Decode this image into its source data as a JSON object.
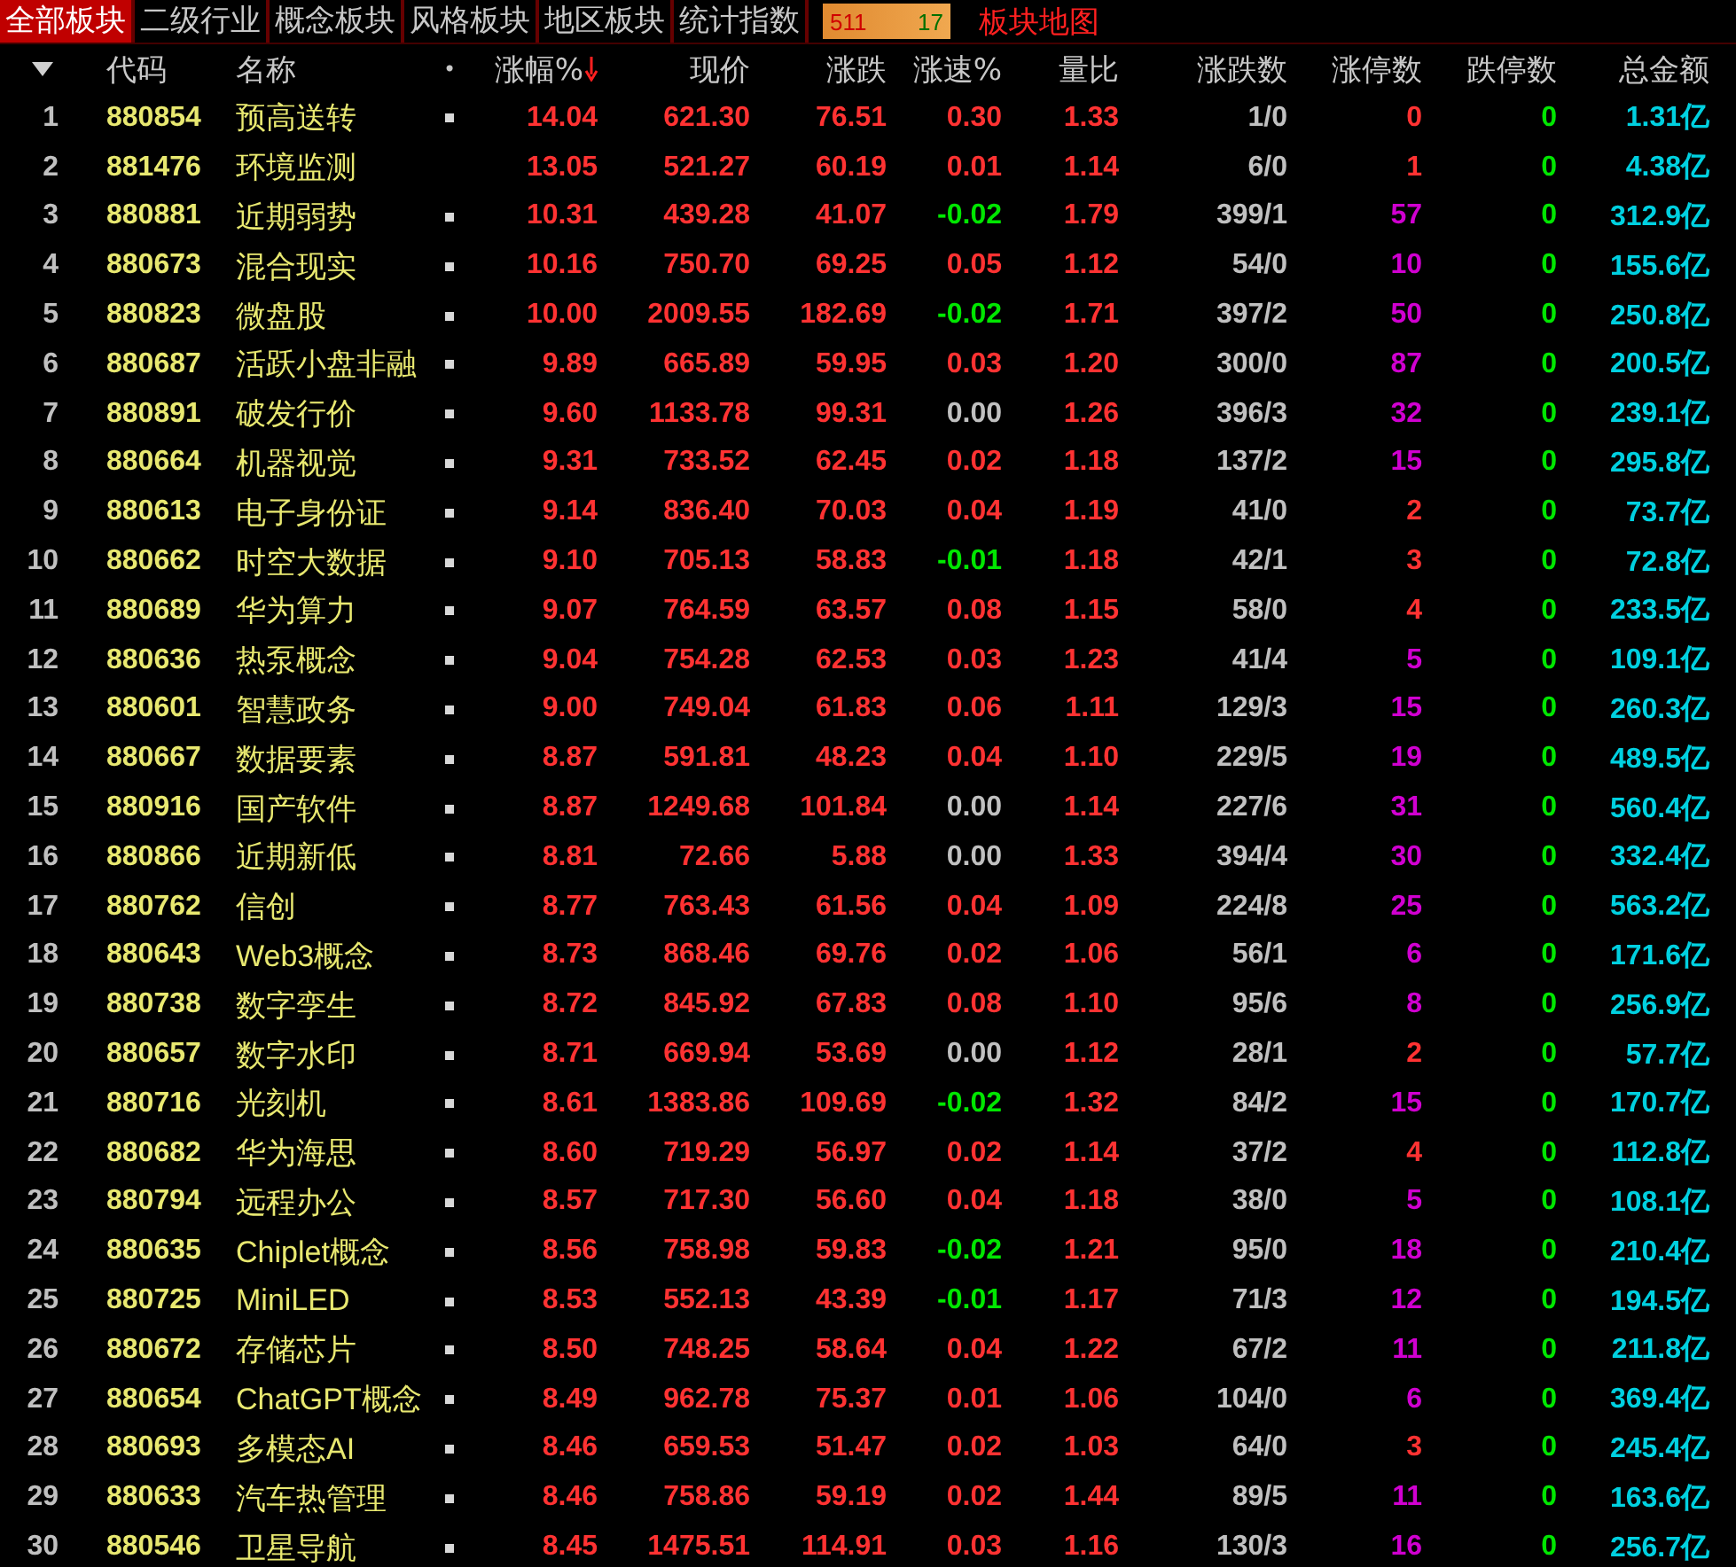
{
  "tabs": [
    {
      "label": "全部板块",
      "selected": true
    },
    {
      "label": "二级行业",
      "selected": false
    },
    {
      "label": "概念板块",
      "selected": false
    },
    {
      "label": "风格板块",
      "selected": false
    },
    {
      "label": "地区板块",
      "selected": false
    },
    {
      "label": "统计指数",
      "selected": false
    }
  ],
  "counter": {
    "up": "511",
    "down": "17"
  },
  "map_link": "板块地图",
  "columns": [
    {
      "label": "代码",
      "sorted": false
    },
    {
      "label": "名称",
      "sorted": false
    },
    {
      "label": "•",
      "sorted": false
    },
    {
      "label": "涨幅%",
      "sorted": true
    },
    {
      "label": "现价",
      "sorted": false
    },
    {
      "label": "涨跌",
      "sorted": false
    },
    {
      "label": "涨速%",
      "sorted": false
    },
    {
      "label": "量比",
      "sorted": false
    },
    {
      "label": "涨跌数",
      "sorted": false
    },
    {
      "label": "涨停数",
      "sorted": false
    },
    {
      "label": "跌停数",
      "sorted": false
    },
    {
      "label": "总金额",
      "sorted": false
    }
  ],
  "rows": [
    {
      "index": "1",
      "code": "880854",
      "name": "预高送转",
      "marked": true,
      "pct": "14.04",
      "price": "621.30",
      "change": "76.51",
      "speed": {
        "text": "0.30",
        "color": "#ff3232"
      },
      "ratio": "1.33",
      "up_down": "1/0",
      "limit_up": {
        "text": "0",
        "color": "#ff3232"
      },
      "limit_down": "0",
      "amount": "1.31亿"
    },
    {
      "index": "2",
      "code": "881476",
      "name": "环境监测",
      "marked": false,
      "pct": "13.05",
      "price": "521.27",
      "change": "60.19",
      "speed": {
        "text": "0.01",
        "color": "#ff3232"
      },
      "ratio": "1.14",
      "up_down": "6/0",
      "limit_up": {
        "text": "1",
        "color": "#ff3232"
      },
      "limit_down": "0",
      "amount": "4.38亿"
    },
    {
      "index": "3",
      "code": "880881",
      "name": "近期弱势",
      "marked": true,
      "pct": "10.31",
      "price": "439.28",
      "change": "41.07",
      "speed": {
        "text": "-0.02",
        "color": "#00e600"
      },
      "ratio": "1.79",
      "up_down": "399/1",
      "limit_up": {
        "text": "57",
        "color": "#d000d0"
      },
      "limit_down": "0",
      "amount": "312.9亿"
    },
    {
      "index": "4",
      "code": "880673",
      "name": "混合现实",
      "marked": true,
      "pct": "10.16",
      "price": "750.70",
      "change": "69.25",
      "speed": {
        "text": "0.05",
        "color": "#ff3232"
      },
      "ratio": "1.12",
      "up_down": "54/0",
      "limit_up": {
        "text": "10",
        "color": "#d000d0"
      },
      "limit_down": "0",
      "amount": "155.6亿"
    },
    {
      "index": "5",
      "code": "880823",
      "name": "微盘股",
      "marked": true,
      "pct": "10.00",
      "price": "2009.55",
      "change": "182.69",
      "speed": {
        "text": "-0.02",
        "color": "#00e600"
      },
      "ratio": "1.71",
      "up_down": "397/2",
      "limit_up": {
        "text": "50",
        "color": "#d000d0"
      },
      "limit_down": "0",
      "amount": "250.8亿"
    },
    {
      "index": "6",
      "code": "880687",
      "name": "活跃小盘非融",
      "marked": true,
      "pct": "9.89",
      "price": "665.89",
      "change": "59.95",
      "speed": {
        "text": "0.03",
        "color": "#ff3232"
      },
      "ratio": "1.20",
      "up_down": "300/0",
      "limit_up": {
        "text": "87",
        "color": "#d000d0"
      },
      "limit_down": "0",
      "amount": "200.5亿"
    },
    {
      "index": "7",
      "code": "880891",
      "name": "破发行价",
      "marked": true,
      "pct": "9.60",
      "price": "1133.78",
      "change": "99.31",
      "speed": {
        "text": "0.00",
        "color": "#c0c0c0"
      },
      "ratio": "1.26",
      "up_down": "396/3",
      "limit_up": {
        "text": "32",
        "color": "#d000d0"
      },
      "limit_down": "0",
      "amount": "239.1亿"
    },
    {
      "index": "8",
      "code": "880664",
      "name": "机器视觉",
      "marked": true,
      "pct": "9.31",
      "price": "733.52",
      "change": "62.45",
      "speed": {
        "text": "0.02",
        "color": "#ff3232"
      },
      "ratio": "1.18",
      "up_down": "137/2",
      "limit_up": {
        "text": "15",
        "color": "#d000d0"
      },
      "limit_down": "0",
      "amount": "295.8亿"
    },
    {
      "index": "9",
      "code": "880613",
      "name": "电子身份证",
      "marked": true,
      "pct": "9.14",
      "price": "836.40",
      "change": "70.03",
      "speed": {
        "text": "0.04",
        "color": "#ff3232"
      },
      "ratio": "1.19",
      "up_down": "41/0",
      "limit_up": {
        "text": "2",
        "color": "#ff3232"
      },
      "limit_down": "0",
      "amount": "73.7亿"
    },
    {
      "index": "10",
      "code": "880662",
      "name": "时空大数据",
      "marked": true,
      "pct": "9.10",
      "price": "705.13",
      "change": "58.83",
      "speed": {
        "text": "-0.01",
        "color": "#00e600"
      },
      "ratio": "1.18",
      "up_down": "42/1",
      "limit_up": {
        "text": "3",
        "color": "#ff3232"
      },
      "limit_down": "0",
      "amount": "72.8亿"
    },
    {
      "index": "11",
      "code": "880689",
      "name": "华为算力",
      "marked": true,
      "pct": "9.07",
      "price": "764.59",
      "change": "63.57",
      "speed": {
        "text": "0.08",
        "color": "#ff3232"
      },
      "ratio": "1.15",
      "up_down": "58/0",
      "limit_up": {
        "text": "4",
        "color": "#ff3232"
      },
      "limit_down": "0",
      "amount": "233.5亿"
    },
    {
      "index": "12",
      "code": "880636",
      "name": "热泵概念",
      "marked": true,
      "pct": "9.04",
      "price": "754.28",
      "change": "62.53",
      "speed": {
        "text": "0.03",
        "color": "#ff3232"
      },
      "ratio": "1.23",
      "up_down": "41/4",
      "limit_up": {
        "text": "5",
        "color": "#d000d0"
      },
      "limit_down": "0",
      "amount": "109.1亿"
    },
    {
      "index": "13",
      "code": "880601",
      "name": "智慧政务",
      "marked": true,
      "pct": "9.00",
      "price": "749.04",
      "change": "61.83",
      "speed": {
        "text": "0.06",
        "color": "#ff3232"
      },
      "ratio": "1.11",
      "up_down": "129/3",
      "limit_up": {
        "text": "15",
        "color": "#d000d0"
      },
      "limit_down": "0",
      "amount": "260.3亿"
    },
    {
      "index": "14",
      "code": "880667",
      "name": "数据要素",
      "marked": true,
      "pct": "8.87",
      "price": "591.81",
      "change": "48.23",
      "speed": {
        "text": "0.04",
        "color": "#ff3232"
      },
      "ratio": "1.10",
      "up_down": "229/5",
      "limit_up": {
        "text": "19",
        "color": "#d000d0"
      },
      "limit_down": "0",
      "amount": "489.5亿"
    },
    {
      "index": "15",
      "code": "880916",
      "name": "国产软件",
      "marked": true,
      "pct": "8.87",
      "price": "1249.68",
      "change": "101.84",
      "speed": {
        "text": "0.00",
        "color": "#c0c0c0"
      },
      "ratio": "1.14",
      "up_down": "227/6",
      "limit_up": {
        "text": "31",
        "color": "#d000d0"
      },
      "limit_down": "0",
      "amount": "560.4亿"
    },
    {
      "index": "16",
      "code": "880866",
      "name": "近期新低",
      "marked": true,
      "pct": "8.81",
      "price": "72.66",
      "change": "5.88",
      "speed": {
        "text": "0.00",
        "color": "#c0c0c0"
      },
      "ratio": "1.33",
      "up_down": "394/4",
      "limit_up": {
        "text": "30",
        "color": "#d000d0"
      },
      "limit_down": "0",
      "amount": "332.4亿"
    },
    {
      "index": "17",
      "code": "880762",
      "name": "信创",
      "marked": true,
      "pct": "8.77",
      "price": "763.43",
      "change": "61.56",
      "speed": {
        "text": "0.04",
        "color": "#ff3232"
      },
      "ratio": "1.09",
      "up_down": "224/8",
      "limit_up": {
        "text": "25",
        "color": "#d000d0"
      },
      "limit_down": "0",
      "amount": "563.2亿"
    },
    {
      "index": "18",
      "code": "880643",
      "name": "Web3概念",
      "marked": true,
      "pct": "8.73",
      "price": "868.46",
      "change": "69.76",
      "speed": {
        "text": "0.02",
        "color": "#ff3232"
      },
      "ratio": "1.06",
      "up_down": "56/1",
      "limit_up": {
        "text": "6",
        "color": "#d000d0"
      },
      "limit_down": "0",
      "amount": "171.6亿"
    },
    {
      "index": "19",
      "code": "880738",
      "name": "数字孪生",
      "marked": true,
      "pct": "8.72",
      "price": "845.92",
      "change": "67.83",
      "speed": {
        "text": "0.08",
        "color": "#ff3232"
      },
      "ratio": "1.10",
      "up_down": "95/6",
      "limit_up": {
        "text": "8",
        "color": "#d000d0"
      },
      "limit_down": "0",
      "amount": "256.9亿"
    },
    {
      "index": "20",
      "code": "880657",
      "name": "数字水印",
      "marked": true,
      "pct": "8.71",
      "price": "669.94",
      "change": "53.69",
      "speed": {
        "text": "0.00",
        "color": "#c0c0c0"
      },
      "ratio": "1.12",
      "up_down": "28/1",
      "limit_up": {
        "text": "2",
        "color": "#ff3232"
      },
      "limit_down": "0",
      "amount": "57.7亿"
    },
    {
      "index": "21",
      "code": "880716",
      "name": "光刻机",
      "marked": true,
      "pct": "8.61",
      "price": "1383.86",
      "change": "109.69",
      "speed": {
        "text": "-0.02",
        "color": "#00e600"
      },
      "ratio": "1.32",
      "up_down": "84/2",
      "limit_up": {
        "text": "15",
        "color": "#d000d0"
      },
      "limit_down": "0",
      "amount": "170.7亿"
    },
    {
      "index": "22",
      "code": "880682",
      "name": "华为海思",
      "marked": true,
      "pct": "8.60",
      "price": "719.29",
      "change": "56.97",
      "speed": {
        "text": "0.02",
        "color": "#ff3232"
      },
      "ratio": "1.14",
      "up_down": "37/2",
      "limit_up": {
        "text": "4",
        "color": "#ff3232"
      },
      "limit_down": "0",
      "amount": "112.8亿"
    },
    {
      "index": "23",
      "code": "880794",
      "name": "远程办公",
      "marked": true,
      "pct": "8.57",
      "price": "717.30",
      "change": "56.60",
      "speed": {
        "text": "0.04",
        "color": "#ff3232"
      },
      "ratio": "1.18",
      "up_down": "38/0",
      "limit_up": {
        "text": "5",
        "color": "#d000d0"
      },
      "limit_down": "0",
      "amount": "108.1亿"
    },
    {
      "index": "24",
      "code": "880635",
      "name": "Chiplet概念",
      "marked": true,
      "pct": "8.56",
      "price": "758.98",
      "change": "59.83",
      "speed": {
        "text": "-0.02",
        "color": "#00e600"
      },
      "ratio": "1.21",
      "up_down": "95/0",
      "limit_up": {
        "text": "18",
        "color": "#d000d0"
      },
      "limit_down": "0",
      "amount": "210.4亿"
    },
    {
      "index": "25",
      "code": "880725",
      "name": "MiniLED",
      "marked": true,
      "pct": "8.53",
      "price": "552.13",
      "change": "43.39",
      "speed": {
        "text": "-0.01",
        "color": "#00e600"
      },
      "ratio": "1.17",
      "up_down": "71/3",
      "limit_up": {
        "text": "12",
        "color": "#d000d0"
      },
      "limit_down": "0",
      "amount": "194.5亿"
    },
    {
      "index": "26",
      "code": "880672",
      "name": "存储芯片",
      "marked": true,
      "pct": "8.50",
      "price": "748.25",
      "change": "58.64",
      "speed": {
        "text": "0.04",
        "color": "#ff3232"
      },
      "ratio": "1.22",
      "up_down": "67/2",
      "limit_up": {
        "text": "11",
        "color": "#d000d0"
      },
      "limit_down": "0",
      "amount": "211.8亿"
    },
    {
      "index": "27",
      "code": "880654",
      "name": "ChatGPT概念",
      "marked": true,
      "pct": "8.49",
      "price": "962.78",
      "change": "75.37",
      "speed": {
        "text": "0.01",
        "color": "#ff3232"
      },
      "ratio": "1.06",
      "up_down": "104/0",
      "limit_up": {
        "text": "6",
        "color": "#d000d0"
      },
      "limit_down": "0",
      "amount": "369.4亿"
    },
    {
      "index": "28",
      "code": "880693",
      "name": "多模态AI",
      "marked": true,
      "pct": "8.46",
      "price": "659.53",
      "change": "51.47",
      "speed": {
        "text": "0.02",
        "color": "#ff3232"
      },
      "ratio": "1.03",
      "up_down": "64/0",
      "limit_up": {
        "text": "3",
        "color": "#ff3232"
      },
      "limit_down": "0",
      "amount": "245.4亿"
    },
    {
      "index": "29",
      "code": "880633",
      "name": "汽车热管理",
      "marked": true,
      "pct": "8.46",
      "price": "758.86",
      "change": "59.19",
      "speed": {
        "text": "0.02",
        "color": "#ff3232"
      },
      "ratio": "1.44",
      "up_down": "89/5",
      "limit_up": {
        "text": "11",
        "color": "#d000d0"
      },
      "limit_down": "0",
      "amount": "163.6亿"
    },
    {
      "index": "30",
      "code": "880546",
      "name": "卫星导航",
      "marked": true,
      "pct": "8.45",
      "price": "1475.51",
      "change": "114.91",
      "speed": {
        "text": "0.03",
        "color": "#ff3232"
      },
      "ratio": "1.16",
      "up_down": "130/3",
      "limit_up": {
        "text": "16",
        "color": "#d000d0"
      },
      "limit_down": "0",
      "amount": "256.7亿"
    }
  ]
}
